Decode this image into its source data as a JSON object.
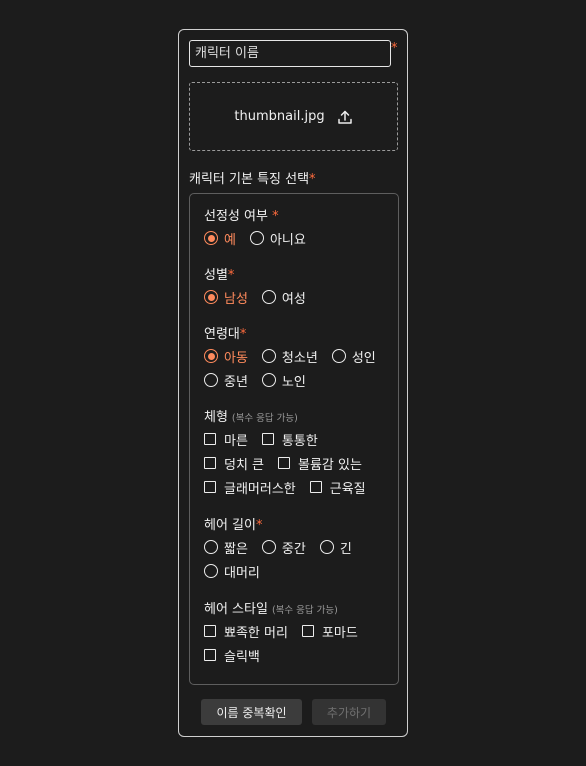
{
  "form": {
    "name_placeholder": "캐릭터 이름",
    "required_mark": "*",
    "upload": {
      "file_name": "thumbnail.jpg",
      "icon": "upload-icon"
    },
    "section_title": "캐릭터 기본 특징 선택",
    "groups": {
      "gender_sensitive": {
        "title": "선정성 여부",
        "options": [
          "예",
          "아니요"
        ],
        "selected": "예"
      },
      "sex": {
        "title": "성별",
        "options": [
          "남성",
          "여성"
        ],
        "selected": "남성"
      },
      "age": {
        "title": "연령대",
        "options": [
          "아동",
          "청소년",
          "성인",
          "중년",
          "노인"
        ],
        "selected": "아동"
      },
      "body": {
        "title": "체형",
        "hint": "(복수 응답 가능)",
        "options": [
          "마른",
          "통통한",
          "덩치 큰",
          "볼륨감 있는",
          "글래머러스한",
          "근육질"
        ]
      },
      "hair_length": {
        "title": "헤어 길이",
        "options": [
          "짧은",
          "중간",
          "긴",
          "대머리"
        ]
      },
      "hair_style": {
        "title": "헤어 스타일",
        "hint": "(복수 응답 가능)",
        "options": [
          "뾰족한 머리",
          "포마드",
          "슬릭백"
        ]
      }
    },
    "buttons": {
      "check_name": "이름 중복확인",
      "add": "추가하기"
    },
    "colors": {
      "accent": "#ff8a5c",
      "required": "#ff6b3d",
      "background": "#1c1c1c"
    }
  }
}
